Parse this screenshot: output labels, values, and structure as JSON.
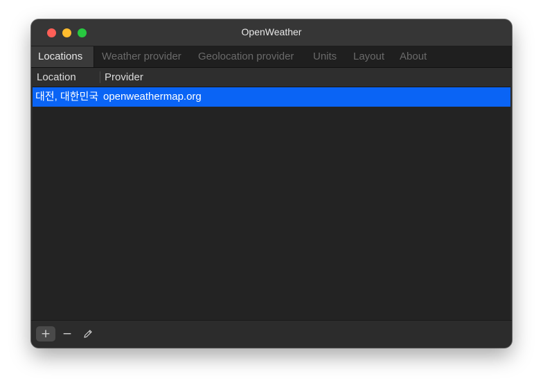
{
  "window": {
    "title": "OpenWeather"
  },
  "tabs": [
    {
      "label": "Locations",
      "active": true
    },
    {
      "label": "Weather provider",
      "active": false
    },
    {
      "label": "Geolocation provider",
      "active": false
    },
    {
      "label": "Units",
      "active": false
    },
    {
      "label": "Layout",
      "active": false
    },
    {
      "label": "About",
      "active": false
    }
  ],
  "table": {
    "columns": [
      "Location",
      "Provider"
    ],
    "rows": [
      {
        "location": "대전, 대한민국",
        "provider": "openweathermap.org",
        "selected": true
      }
    ]
  },
  "toolbar": {
    "add_label": "+",
    "remove_label": "−",
    "edit_icon": "pencil-icon"
  },
  "colors": {
    "selection": "#0a64f5",
    "close": "#ff5f57",
    "minimize": "#febc2e",
    "maximize": "#28c840"
  }
}
